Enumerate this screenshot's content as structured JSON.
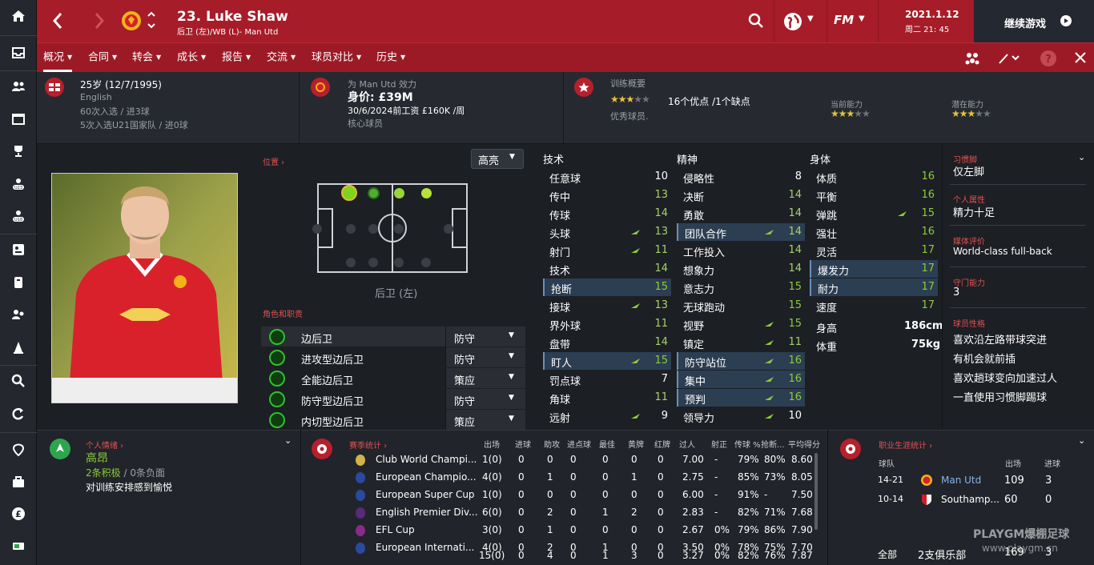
{
  "header": {
    "player_title": "23. Luke Shaw",
    "player_subtitle": "后卫 (左)/WB (L)- Man Utd",
    "date": "2021.1.12",
    "time": "周二 21: 45",
    "continue_label": "继续游戏",
    "fm_logo": "FM"
  },
  "tabs": [
    "概况",
    "合同",
    "转会",
    "成长",
    "报告",
    "交流",
    "球员对比",
    "历史"
  ],
  "info": {
    "age": "25岁 (12/7/1995)",
    "nationality": "English",
    "caps": "60次入选 / 进3球",
    "u21_caps": "5次入选U21国家队 / 进0球",
    "club_line": "为 Man Utd 效力",
    "value": "身价: £39M",
    "contract": "30/6/2024前工资 £160K /周",
    "squad_status": "核心球员",
    "training_label": "训练概要",
    "training_summary": "16个优点 /1个缺点",
    "training_rating": "优秀球员.",
    "current_ability_label": "当前能力",
    "potential_ability_label": "潜在能力",
    "training_stars": 3,
    "current_stars": 3,
    "potential_stars": 3.5
  },
  "position": {
    "label": "位置",
    "highlight_select": "高亮",
    "position_name": "后卫 (左)",
    "roles_label": "角色和职责"
  },
  "roles": [
    {
      "name": "边后卫",
      "duty": "防守"
    },
    {
      "name": "进攻型边后卫",
      "duty": "防守"
    },
    {
      "name": "全能边后卫",
      "duty": "策应"
    },
    {
      "name": "防守型边后卫",
      "duty": "防守"
    },
    {
      "name": "内切型边后卫",
      "duty": "策应"
    }
  ],
  "attributes": {
    "headers": [
      "技术",
      "精神",
      "身体"
    ],
    "technical": [
      {
        "n": "任意球",
        "v": "10"
      },
      {
        "n": "传中",
        "v": "13"
      },
      {
        "n": "传球",
        "v": "14"
      },
      {
        "n": "头球",
        "v": "13",
        "up": true
      },
      {
        "n": "射门",
        "v": "11",
        "up": true
      },
      {
        "n": "技术",
        "v": "14"
      },
      {
        "n": "抢断",
        "v": "15",
        "hl": true
      },
      {
        "n": "接球",
        "v": "13",
        "up": true
      },
      {
        "n": "界外球",
        "v": "11"
      },
      {
        "n": "盘带",
        "v": "14"
      },
      {
        "n": "盯人",
        "v": "15",
        "hl": true,
        "up": true
      },
      {
        "n": "罚点球",
        "v": "7"
      },
      {
        "n": "角球",
        "v": "11"
      },
      {
        "n": "远射",
        "v": "9",
        "up": true
      }
    ],
    "mental": [
      {
        "n": "侵略性",
        "v": "8"
      },
      {
        "n": "决断",
        "v": "14"
      },
      {
        "n": "勇敢",
        "v": "14"
      },
      {
        "n": "团队合作",
        "v": "14",
        "hl": true,
        "up": true
      },
      {
        "n": "工作投入",
        "v": "14"
      },
      {
        "n": "想象力",
        "v": "14"
      },
      {
        "n": "意志力",
        "v": "15"
      },
      {
        "n": "无球跑动",
        "v": "15"
      },
      {
        "n": "视野",
        "v": "15",
        "up": true
      },
      {
        "n": "镇定",
        "v": "11",
        "up": true
      },
      {
        "n": "防守站位",
        "v": "16",
        "hl": true,
        "up": true
      },
      {
        "n": "集中",
        "v": "16",
        "hl": true,
        "up": true
      },
      {
        "n": "预判",
        "v": "16",
        "hl": true,
        "up": true
      },
      {
        "n": "领导力",
        "v": "10",
        "up": true
      }
    ],
    "physical": [
      {
        "n": "体质",
        "v": "16"
      },
      {
        "n": "平衡",
        "v": "16"
      },
      {
        "n": "弹跳",
        "v": "15",
        "up": true
      },
      {
        "n": "强壮",
        "v": "16"
      },
      {
        "n": "灵活",
        "v": "17"
      },
      {
        "n": "爆发力",
        "v": "17",
        "hl": true
      },
      {
        "n": "耐力",
        "v": "17",
        "hl": true
      },
      {
        "n": "速度",
        "v": "17"
      }
    ],
    "height_label": "身高",
    "height": "186cm",
    "weight_label": "体重",
    "weight": "75kg"
  },
  "right_panel": {
    "foot_label": "习惯脚",
    "foot": "仅左脚",
    "trait_label": "个人属性",
    "trait": "精力十足",
    "media_label": "媒体评价",
    "media": "World-class full-back",
    "gk_label": "守门能力",
    "gk": "3",
    "pref_label": "球员性格",
    "prefs": [
      "喜欢沿左路带球突进",
      "有机会就前插",
      "喜欢趟球变向加速过人",
      "一直使用习惯脚踢球"
    ]
  },
  "morale": {
    "label": "个人情绪",
    "value": "高昂",
    "positive": "2条积极",
    "negative": " / 0条负面",
    "note": "对训练安排感到愉悦"
  },
  "season": {
    "label": "赛季统计",
    "columns": [
      "出场",
      "进球",
      "助攻",
      "进点球",
      "最佳",
      "黄牌",
      "红牌",
      "过人",
      "射正",
      "传球 %",
      "抢断...",
      "平均得分"
    ],
    "rows": [
      {
        "comp": "Club World Champi...",
        "v": [
          "1(0)",
          "0",
          "0",
          "0",
          "0",
          "0",
          "0",
          "7.00",
          "-",
          "79%",
          "80%",
          "8.60"
        ]
      },
      {
        "comp": "European Champio...",
        "v": [
          "4(0)",
          "0",
          "1",
          "0",
          "0",
          "1",
          "0",
          "2.75",
          "-",
          "85%",
          "73%",
          "8.05"
        ]
      },
      {
        "comp": "European Super Cup",
        "v": [
          "1(0)",
          "0",
          "0",
          "0",
          "0",
          "0",
          "0",
          "6.00",
          "-",
          "91%",
          "-",
          "7.50"
        ]
      },
      {
        "comp": "English Premier Div...",
        "v": [
          "6(0)",
          "0",
          "2",
          "0",
          "1",
          "2",
          "0",
          "2.83",
          "-",
          "82%",
          "71%",
          "7.68"
        ]
      },
      {
        "comp": "EFL Cup",
        "v": [
          "3(0)",
          "0",
          "1",
          "0",
          "0",
          "0",
          "0",
          "2.67",
          "0%",
          "79%",
          "86%",
          "7.90"
        ]
      },
      {
        "comp": "European Internati...",
        "v": [
          "4(0)",
          "0",
          "2",
          "0",
          "1",
          "0",
          "0",
          "3.50",
          "0%",
          "78%",
          "75%",
          "7.70"
        ]
      }
    ],
    "total": [
      "15(0)",
      "0",
      "4",
      "0",
      "1",
      "3",
      "0",
      "3.27",
      "0%",
      "82%",
      "76%",
      "7.87"
    ]
  },
  "career": {
    "label": "职业生涯统计",
    "col_team": "球队",
    "col_apps": "出场",
    "col_goals": "进球",
    "rows": [
      {
        "years": "14-21",
        "team": "Man Utd",
        "apps": "109",
        "goals": "3"
      },
      {
        "years": "10-14",
        "team": "Southamp...",
        "apps": "60",
        "goals": "0"
      }
    ],
    "total_label": "全部",
    "total_team": "2支俱乐部",
    "total_apps": "169",
    "total_goals": "3"
  },
  "watermark": {
    "line1": "PLAYGM爆棚足球",
    "line2": "www.playgm.cn"
  },
  "colors": {
    "header_red": "#a61c28",
    "accent_green": "#8ccc3a",
    "highlight": "#2c3e52"
  }
}
